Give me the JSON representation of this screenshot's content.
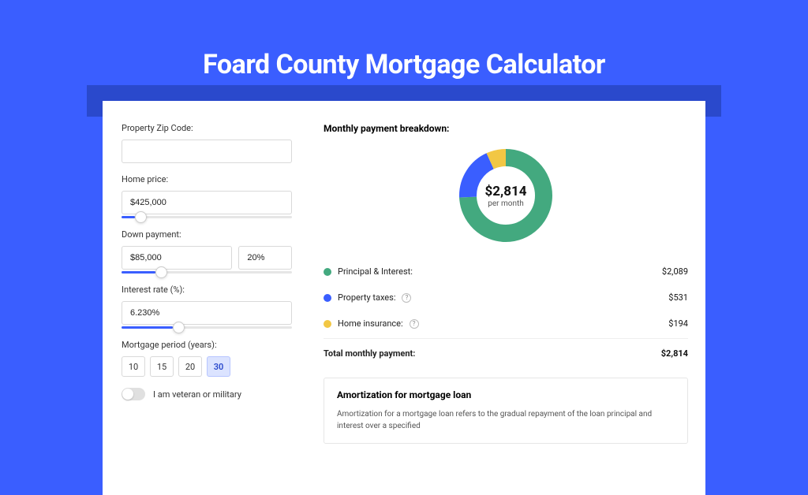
{
  "title": "Foard County Mortgage Calculator",
  "form": {
    "zip": {
      "label": "Property Zip Code:",
      "value": ""
    },
    "home_price": {
      "label": "Home price:",
      "value": "$425,000",
      "slider_pct": 8
    },
    "down_payment": {
      "label": "Down payment:",
      "value_amount": "$85,000",
      "value_pct": "20%",
      "slider_pct": 20
    },
    "interest": {
      "label": "Interest rate (%):",
      "value": "6.230%",
      "slider_pct": 30
    },
    "period": {
      "label": "Mortgage period (years):",
      "options": [
        "10",
        "15",
        "20",
        "30"
      ],
      "selected": "30"
    },
    "veteran": {
      "label": "I am veteran or military",
      "checked": false
    }
  },
  "breakdown": {
    "title": "Monthly payment breakdown:",
    "total_amount": "$2,814",
    "total_sub": "per month",
    "items": [
      {
        "label": "Principal & Interest:",
        "value": "$2,089",
        "color": "#43a97f",
        "has_info": false
      },
      {
        "label": "Property taxes:",
        "value": "$531",
        "color": "#3a5eff",
        "has_info": true
      },
      {
        "label": "Home insurance:",
        "value": "$194",
        "color": "#f2c744",
        "has_info": true
      }
    ],
    "total_row": {
      "label": "Total monthly payment:",
      "value": "$2,814"
    }
  },
  "amortization": {
    "title": "Amortization for mortgage loan",
    "text": "Amortization for a mortgage loan refers to the gradual repayment of the loan principal and interest over a specified"
  },
  "chart_data": {
    "type": "pie",
    "title": "Monthly payment breakdown",
    "series": [
      {
        "name": "Principal & Interest",
        "value": 2089
      },
      {
        "name": "Property taxes",
        "value": 531
      },
      {
        "name": "Home insurance",
        "value": 194
      }
    ],
    "total": 2814,
    "total_label": "per month",
    "colors": [
      "#43a97f",
      "#3a5eff",
      "#f2c744"
    ]
  }
}
